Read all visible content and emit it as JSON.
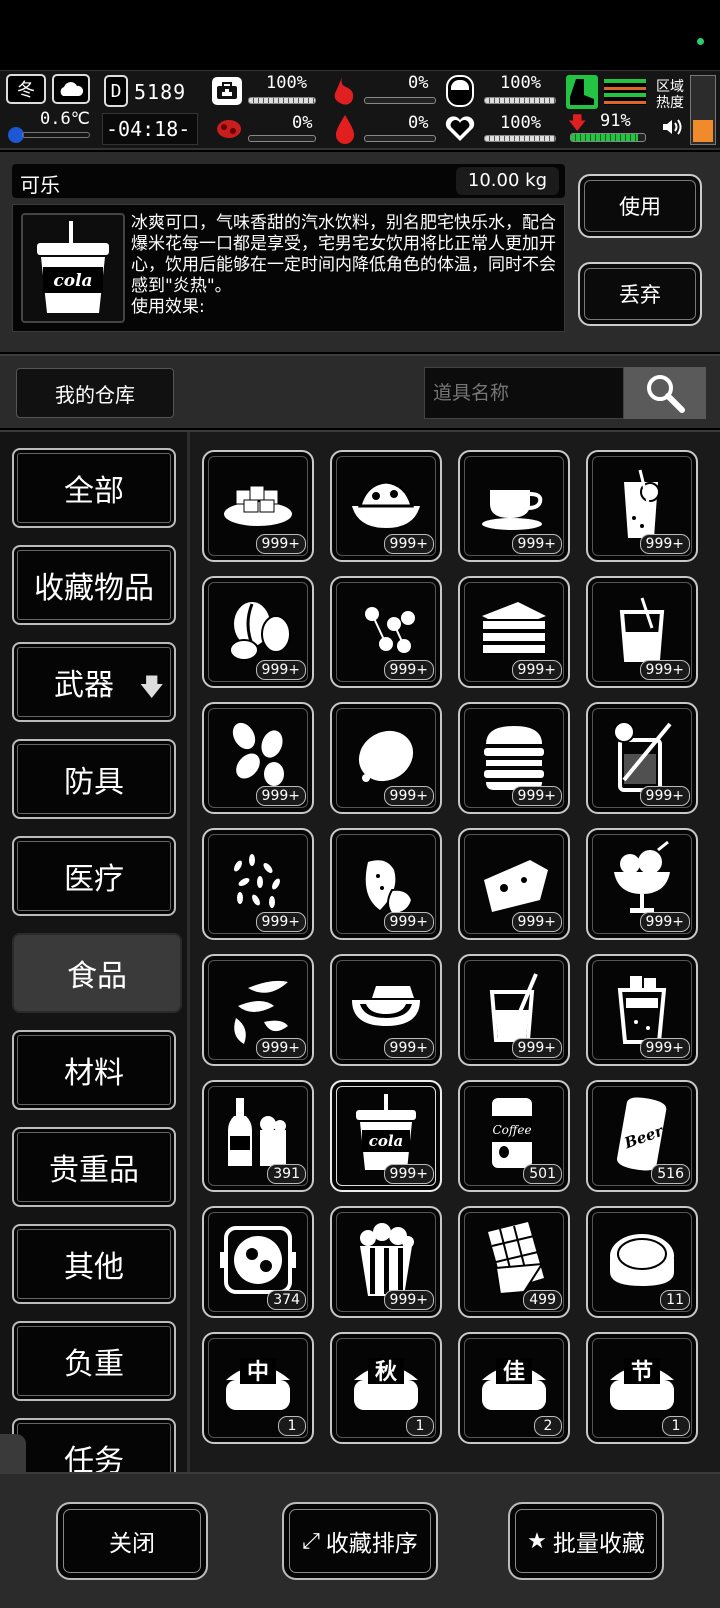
{
  "hud": {
    "season": "冬",
    "temperature": "0.6℃",
    "day_label": "D",
    "day_number": "5189",
    "clock": "-04:18-",
    "health_pct": "100%",
    "stomach_pct": "0%",
    "digest_pct": "100%",
    "infection_pct": "0%",
    "blood_pct": "0%",
    "mood_pct": "100%",
    "energy_pct": "91%",
    "zone_heat_label": "区域\n热度",
    "health_level": 1.0,
    "stomach_level": 0.0,
    "digest_level": 1.0,
    "infection_level": 0.0,
    "blood_level": 0.0,
    "mood_level": 1.0,
    "energy_level": 0.91
  },
  "detail": {
    "item_name": "可乐",
    "item_weight": "10.00 kg",
    "description": "冰爽可口，气味香甜的汽水饮料，别名肥宅快乐水，配合爆米花每一口都是享受，宅男宅女饮用将比正常人更加开心，饮用后能够在一定时间内降低角色的体温，同时不会感到\"炎热\"。",
    "effect_label": "使用效果:",
    "icon_text": "cola",
    "use_label": "使用",
    "discard_label": "丢弃"
  },
  "search": {
    "warehouse_tab": "我的仓库",
    "placeholder": "道具名称"
  },
  "categories": [
    {
      "label": "全部"
    },
    {
      "label": "收藏物品"
    },
    {
      "label": "武器",
      "arrow": "🡇"
    },
    {
      "label": "防具"
    },
    {
      "label": "医疗"
    },
    {
      "label": "食品",
      "active": true
    },
    {
      "label": "材料"
    },
    {
      "label": "贵重品"
    },
    {
      "label": "其他"
    },
    {
      "label": "负重"
    },
    {
      "label": "任务"
    }
  ],
  "items": [
    {
      "icon": "sugar-cubes-icon",
      "count": "999+"
    },
    {
      "icon": "fruit-bowl-icon",
      "count": "999+"
    },
    {
      "icon": "coffee-cup-icon",
      "count": "999+"
    },
    {
      "icon": "lemonade-glass-icon",
      "count": "999+"
    },
    {
      "icon": "coffee-beans-icon",
      "count": "999+"
    },
    {
      "icon": "berries-icon",
      "count": "999+"
    },
    {
      "icon": "sandwich-icon",
      "count": "999+"
    },
    {
      "icon": "juice-glass-icon",
      "count": "999+"
    },
    {
      "icon": "peanuts-icon",
      "count": "999+"
    },
    {
      "icon": "lemon-icon",
      "count": "999+"
    },
    {
      "icon": "burger-icon",
      "count": "999+"
    },
    {
      "icon": "lemon-drink-icon",
      "count": "999+"
    },
    {
      "icon": "seeds-icon",
      "count": "999+"
    },
    {
      "icon": "strawberry-icon",
      "count": "999+"
    },
    {
      "icon": "cheese-icon",
      "count": "999+"
    },
    {
      "icon": "ice-cream-sundae-icon",
      "count": "999+"
    },
    {
      "icon": "almonds-icon",
      "count": "999+"
    },
    {
      "icon": "watermelon-icon",
      "count": "999+"
    },
    {
      "icon": "soda-glass-icon",
      "count": "999+"
    },
    {
      "icon": "iced-drink-icon",
      "count": "999+"
    },
    {
      "icon": "beer-bottle-icon",
      "count": "391"
    },
    {
      "icon": "cola-cup-icon",
      "count": "999+",
      "selected": true,
      "text": "cola"
    },
    {
      "icon": "coffee-can-icon",
      "count": "501",
      "text": "Coffee"
    },
    {
      "icon": "beer-can-icon",
      "count": "516",
      "text": "Beer"
    },
    {
      "icon": "hotpot-icon",
      "count": "374"
    },
    {
      "icon": "popcorn-icon",
      "count": "999+"
    },
    {
      "icon": "chocolate-bar-icon",
      "count": "499"
    },
    {
      "icon": "mooncake-icon",
      "count": "11"
    },
    {
      "icon": "mooncake-zhong-icon",
      "count": "1",
      "text": "中"
    },
    {
      "icon": "mooncake-qiu-icon",
      "count": "1",
      "text": "秋"
    },
    {
      "icon": "mooncake-jia-icon",
      "count": "2",
      "text": "佳"
    },
    {
      "icon": "mooncake-jie-icon",
      "count": "1",
      "text": "节"
    }
  ],
  "bottom": {
    "close_label": "关闭",
    "sort_label": "收藏排序",
    "batch_label": "批量收藏"
  }
}
